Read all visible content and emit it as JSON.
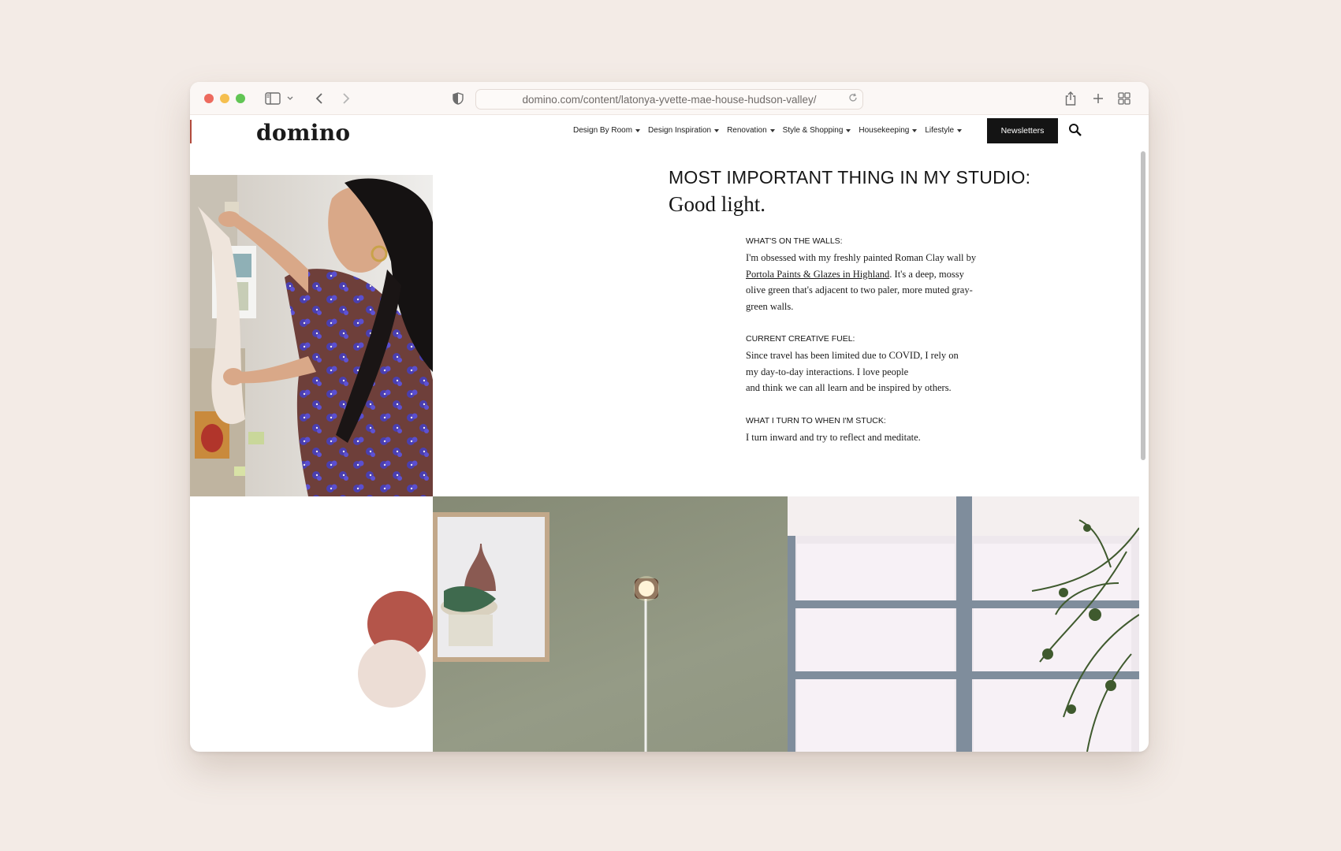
{
  "browser": {
    "url": "domino.com/content/latonya-yvette-mae-house-hudson-valley/",
    "icons": {
      "sidebar": "sidebar-icon",
      "back": "chevron-left-icon",
      "forward": "chevron-right-icon",
      "privacy": "shield-icon",
      "reload": "reload-icon",
      "share": "share-icon",
      "new_tab": "plus-icon",
      "tabs": "tab-overview-icon"
    }
  },
  "site": {
    "logo": "domino",
    "nav": [
      {
        "label": "Design By Room"
      },
      {
        "label": "Design Inspiration"
      },
      {
        "label": "Renovation"
      },
      {
        "label": "Style & Shopping"
      },
      {
        "label": "Housekeeping"
      },
      {
        "label": "Lifestyle"
      }
    ],
    "newsletter_label": "Newsletters",
    "search_icon": "search-icon"
  },
  "article": {
    "heading": "MOST IMPORTANT THING IN MY STUDIO:",
    "heading_answer": "Good light.",
    "qa": [
      {
        "label": "WHAT'S ON THE WALLS:",
        "text_before": "I'm obsessed with my freshly painted Roman Clay wall by ",
        "link": "Portola Paints & Glazes in Highland",
        "text_after": ". It's a deep, mossy olive green that's adjacent to two paler, more muted gray-green walls."
      },
      {
        "label": "CURRENT CREATIVE FUEL:",
        "lines": [
          "Since travel has been limited due to COVID, I rely on",
          "my day-to-day interactions. I love people",
          "and think we can all learn and be inspired by others."
        ]
      },
      {
        "label": "WHAT I TURN TO WHEN I'M STUCK:",
        "lines": [
          "I turn inward and try to reflect and meditate."
        ]
      }
    ]
  },
  "colors": {
    "page_bg": "#f3ebe6",
    "accent_circle": "#b4554a",
    "pale_circle": "#ecddd5",
    "wall_green": "#8a917c",
    "shirt": "#6a3e3c"
  }
}
